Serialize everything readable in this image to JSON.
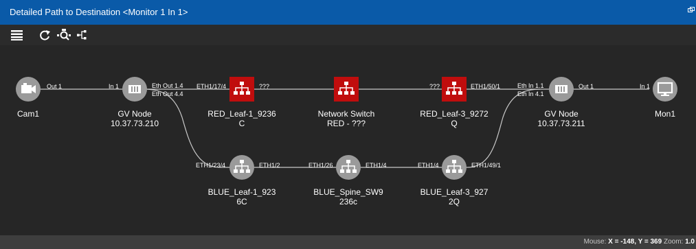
{
  "window": {
    "title": "Detailed Path to Destination <Monitor 1 In 1>"
  },
  "toolbar": {
    "icons": [
      "list-icon",
      "refresh-icon",
      "device-search-icon",
      "topology-icon"
    ]
  },
  "nodes": {
    "cam1": {
      "name": "Cam1",
      "port_out": "Out 1"
    },
    "gv1": {
      "name": "GV Node",
      "ip": "10.37.73.210",
      "port_in": "In 1",
      "port_out1": "Eth Out 1.4",
      "port_out2": "Eth Out 4.4"
    },
    "red1": {
      "name": "RED_Leaf-1_9236",
      "sub": "C",
      "port_in": "ETH1/17/4",
      "port_out": "???"
    },
    "ns": {
      "name": "Network Switch",
      "sub": "RED - ???"
    },
    "red3": {
      "name": "RED_Leaf-3_9272",
      "sub": "Q",
      "port_in": "???",
      "port_out": "ETH1/50/1"
    },
    "gv2": {
      "name": "GV Node",
      "ip": "10.37.73.211",
      "port_in1": "Eth In 1.1",
      "port_in2": "Eth In 4.1",
      "port_out": "Out 1"
    },
    "mon1": {
      "name": "Mon1",
      "port_in": "In 1"
    },
    "blue1": {
      "name": "BLUE_Leaf-1_923",
      "sub": "6C",
      "port_in": "ETH1/23/4",
      "port_out": "ETH1/2"
    },
    "spine": {
      "name": "BLUE_Spine_SW9",
      "sub": "236c",
      "port_in": "ETH1/26",
      "port_out": "ETH1/4"
    },
    "blue3": {
      "name": "BLUE_Leaf-3_927",
      "sub": "2Q",
      "port_in": "ETH1/4",
      "port_out": "ETH1/49/1"
    }
  },
  "status": {
    "mouse_label": "Mouse:",
    "x_text": "X = -148, Y = 369",
    "zoom_label": "Zoom:",
    "zoom_value": "1.0"
  },
  "colors": {
    "titlebar": "#0a5aa8",
    "canvas": "#262626",
    "red_node": "#c00d0d",
    "grey_node": "#9a9a9a"
  }
}
